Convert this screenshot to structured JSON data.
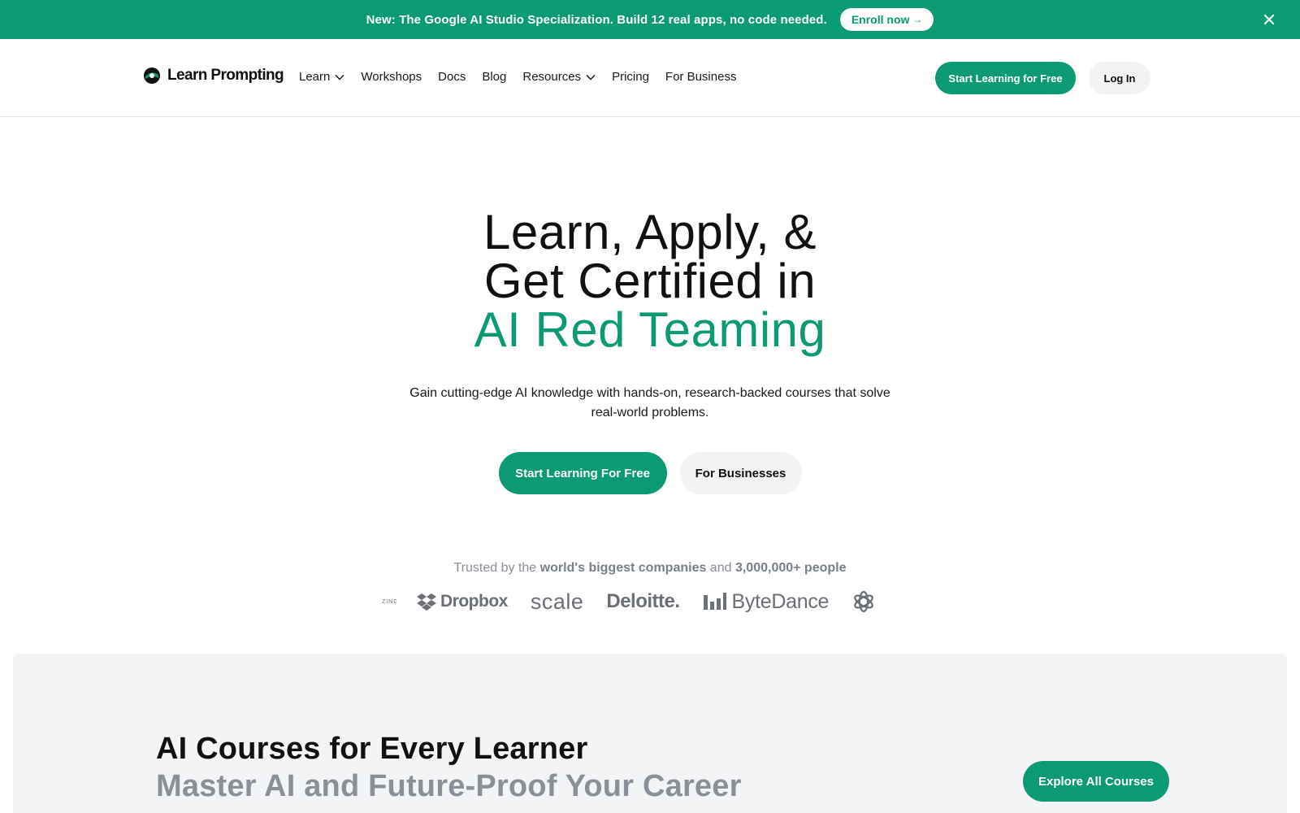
{
  "banner": {
    "text": "New: The Google AI Studio Specialization. Build 12 real apps, no code needed.",
    "enroll_label": "Enroll now",
    "enroll_arrow": "→",
    "close_icon": "close-icon"
  },
  "nav": {
    "logo_text": "Learn Prompting",
    "items": [
      {
        "label": "Learn",
        "has_dropdown": true
      },
      {
        "label": "Workshops",
        "has_dropdown": false
      },
      {
        "label": "Docs",
        "has_dropdown": false
      },
      {
        "label": "Blog",
        "has_dropdown": false
      },
      {
        "label": "Resources",
        "has_dropdown": true
      },
      {
        "label": "Pricing",
        "has_dropdown": false
      },
      {
        "label": "For Business",
        "has_dropdown": false
      }
    ],
    "start_label": "Start Learning for Free",
    "login_label": "Log In"
  },
  "hero": {
    "line1": "Learn, Apply, &",
    "line2": "Get Certified in",
    "line3": "AI Red Teaming",
    "subtitle": "Gain cutting-edge AI knowledge with hands-on, research-backed courses that solve real-world problems.",
    "primary_label": "Start Learning For Free",
    "secondary_label": "For Businesses"
  },
  "trusted": {
    "prefix": "Trusted by the ",
    "bold1": "world's biggest companies",
    "middle": " and ",
    "bold2": "3,000,000+ people",
    "logos": {
      "cut": "ZING",
      "dropbox": "Dropbox",
      "scale": "scale",
      "deloitte": "Deloitte.",
      "bytedance": "ByteDance",
      "openai_icon": "openai-icon"
    }
  },
  "courses": {
    "title": "AI Courses for Every Learner",
    "subtitle": "Master AI and Future-Proof Your Career",
    "explore_label": "Explore All Courses"
  },
  "colors": {
    "brand": "#0b9a74",
    "muted": "#8a8f98",
    "section_bg": "#f3f4f6"
  }
}
